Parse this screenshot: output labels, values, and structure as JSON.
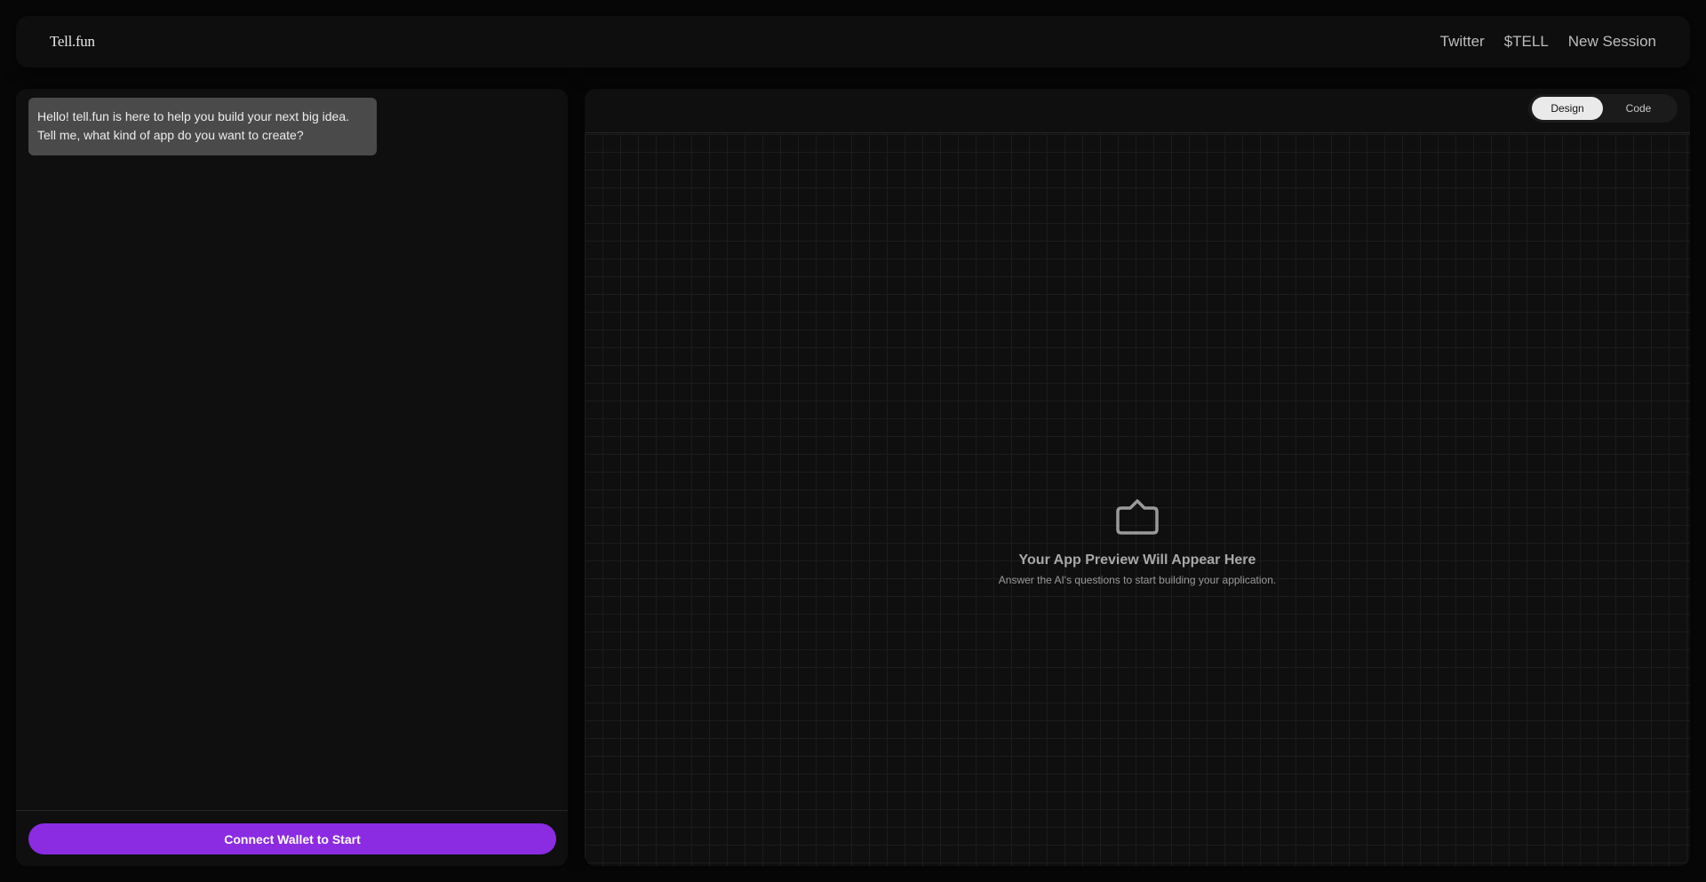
{
  "header": {
    "logo": "Tell.fun",
    "nav": [
      {
        "label": "Twitter"
      },
      {
        "label": "$TELL"
      },
      {
        "label": "New Session"
      }
    ]
  },
  "chat": {
    "messages": [
      {
        "role": "assistant",
        "text": "Hello! tell.fun is here to help you build your next big idea. Tell me, what kind of app do you want to create?"
      }
    ],
    "connect_button": "Connect Wallet to Start",
    "accent_color": "#8b2be2"
  },
  "preview": {
    "tabs": [
      {
        "label": "Design",
        "active": true
      },
      {
        "label": "Code",
        "active": false
      }
    ],
    "empty_icon": "folder-icon",
    "empty_title": "Your App Preview Will Appear Here",
    "empty_subtitle": "Answer the AI's questions to start building your application."
  }
}
